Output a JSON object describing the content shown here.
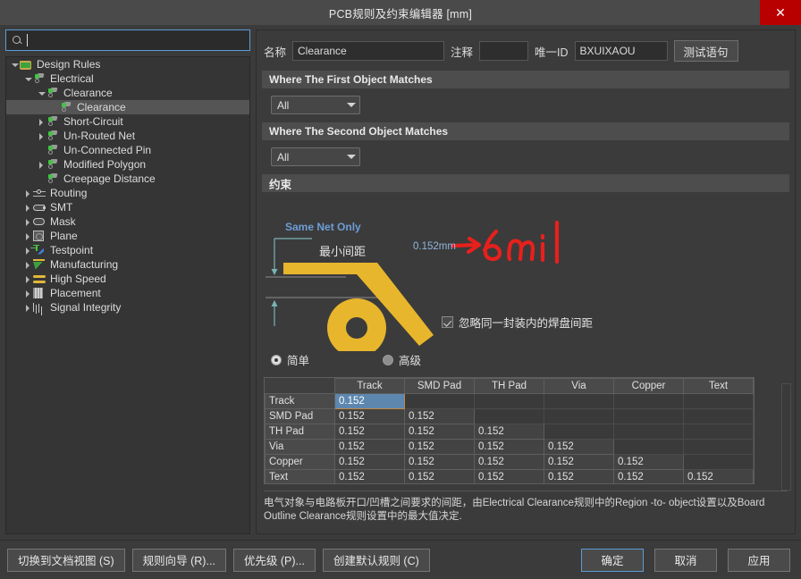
{
  "window": {
    "title": "PCB规则及约束编辑器 [mm]",
    "close_label": "✕",
    "close_icon": "close-icon"
  },
  "sidebar": {
    "search": {
      "value": "",
      "placeholder": "",
      "icon": "search-icon"
    },
    "tree": [
      {
        "label": "Design Rules",
        "depth": 0,
        "arrow": "down",
        "icon": "folder-icon",
        "selected": false
      },
      {
        "label": "Electrical",
        "depth": 1,
        "arrow": "down",
        "icon": "rule-icon",
        "selected": false
      },
      {
        "label": "Clearance",
        "depth": 2,
        "arrow": "down",
        "icon": "rule-icon",
        "selected": false
      },
      {
        "label": "Clearance",
        "depth": 3,
        "arrow": "none",
        "icon": "rule-icon",
        "selected": true
      },
      {
        "label": "Short-Circuit",
        "depth": 2,
        "arrow": "right",
        "icon": "rule-icon",
        "selected": false
      },
      {
        "label": "Un-Routed Net",
        "depth": 2,
        "arrow": "right",
        "icon": "rule-icon",
        "selected": false
      },
      {
        "label": "Un-Connected Pin",
        "depth": 2,
        "arrow": "none",
        "icon": "rule-icon",
        "selected": false
      },
      {
        "label": "Modified Polygon",
        "depth": 2,
        "arrow": "right",
        "icon": "rule-icon",
        "selected": false
      },
      {
        "label": "Creepage Distance",
        "depth": 2,
        "arrow": "none",
        "icon": "rule-icon",
        "selected": false
      },
      {
        "label": "Routing",
        "depth": 1,
        "arrow": "right",
        "icon": "routing-icon",
        "selected": false
      },
      {
        "label": "SMT",
        "depth": 1,
        "arrow": "right",
        "icon": "smt-icon",
        "selected": false
      },
      {
        "label": "Mask",
        "depth": 1,
        "arrow": "right",
        "icon": "mask-icon",
        "selected": false
      },
      {
        "label": "Plane",
        "depth": 1,
        "arrow": "right",
        "icon": "plane-icon",
        "selected": false
      },
      {
        "label": "Testpoint",
        "depth": 1,
        "arrow": "right",
        "icon": "testpoint-icon",
        "selected": false
      },
      {
        "label": "Manufacturing",
        "depth": 1,
        "arrow": "right",
        "icon": "manufacturing-icon",
        "selected": false
      },
      {
        "label": "High Speed",
        "depth": 1,
        "arrow": "right",
        "icon": "highspeed-icon",
        "selected": false
      },
      {
        "label": "Placement",
        "depth": 1,
        "arrow": "right",
        "icon": "placement-icon",
        "selected": false
      },
      {
        "label": "Signal Integrity",
        "depth": 1,
        "arrow": "right",
        "icon": "signal-integrity-icon",
        "selected": false
      }
    ]
  },
  "form": {
    "name_label": "名称",
    "name_value": "Clearance",
    "comment_label": "注释",
    "comment_value": "",
    "uid_label": "唯一ID",
    "uid_value": "BXUIXAOU",
    "test_button": "测试语句"
  },
  "first_match": {
    "header": "Where The First Object Matches",
    "scope_value": "All"
  },
  "second_match": {
    "header": "Where The Second Object Matches",
    "scope_value": "All"
  },
  "constraint": {
    "header": "约束",
    "same_net_label": "Same Net Only",
    "min_gap_label": "最小间距",
    "gap_value": "0.152mm",
    "annotation": "→6mil",
    "ignore_pad_checkbox": {
      "label": "忽略同一封装内的焊盘间距",
      "checked": true
    },
    "mode_simple": "简单",
    "mode_advanced": "高级",
    "mode_selected": "简单"
  },
  "matrix": {
    "columns": [
      "Track",
      "SMD Pad",
      "TH Pad",
      "Via",
      "Copper",
      "Text"
    ],
    "rows": [
      {
        "label": "Track",
        "values": [
          "0.152",
          "",
          "",
          "",
          "",
          ""
        ]
      },
      {
        "label": "SMD Pad",
        "values": [
          "0.152",
          "0.152",
          "",
          "",
          "",
          ""
        ]
      },
      {
        "label": "TH Pad",
        "values": [
          "0.152",
          "0.152",
          "0.152",
          "",
          "",
          ""
        ]
      },
      {
        "label": "Via",
        "values": [
          "0.152",
          "0.152",
          "0.152",
          "0.152",
          "",
          ""
        ]
      },
      {
        "label": "Copper",
        "values": [
          "0.152",
          "0.152",
          "0.152",
          "0.152",
          "0.152",
          ""
        ]
      },
      {
        "label": "Text",
        "values": [
          "0.152",
          "0.152",
          "0.152",
          "0.152",
          "0.152",
          "0.152"
        ]
      }
    ],
    "selected_cell": {
      "row": 0,
      "col": 0
    }
  },
  "hint": "电气对象与电路板开口/凹槽之间要求的间距，由Electrical Clearance规则中的Region -to- object设置以及Board Outline Clearance规则设置中的最大值决定.",
  "footer": {
    "switch_view": "切换到文档视图 (S)",
    "rule_wizard": "规则向导 (R)...",
    "priority": "优先级 (P)...",
    "create_default": "创建默认规则 (C)",
    "ok": "确定",
    "cancel": "取消",
    "apply": "应用"
  },
  "colors": {
    "accent_blue": "#5b9bd5",
    "track_yellow": "#e8b62c",
    "annotation_red": "#e8201c",
    "dimension_teal": "#79b3b3",
    "close_red": "#b90000",
    "selection_blue": "#5d87ae"
  }
}
